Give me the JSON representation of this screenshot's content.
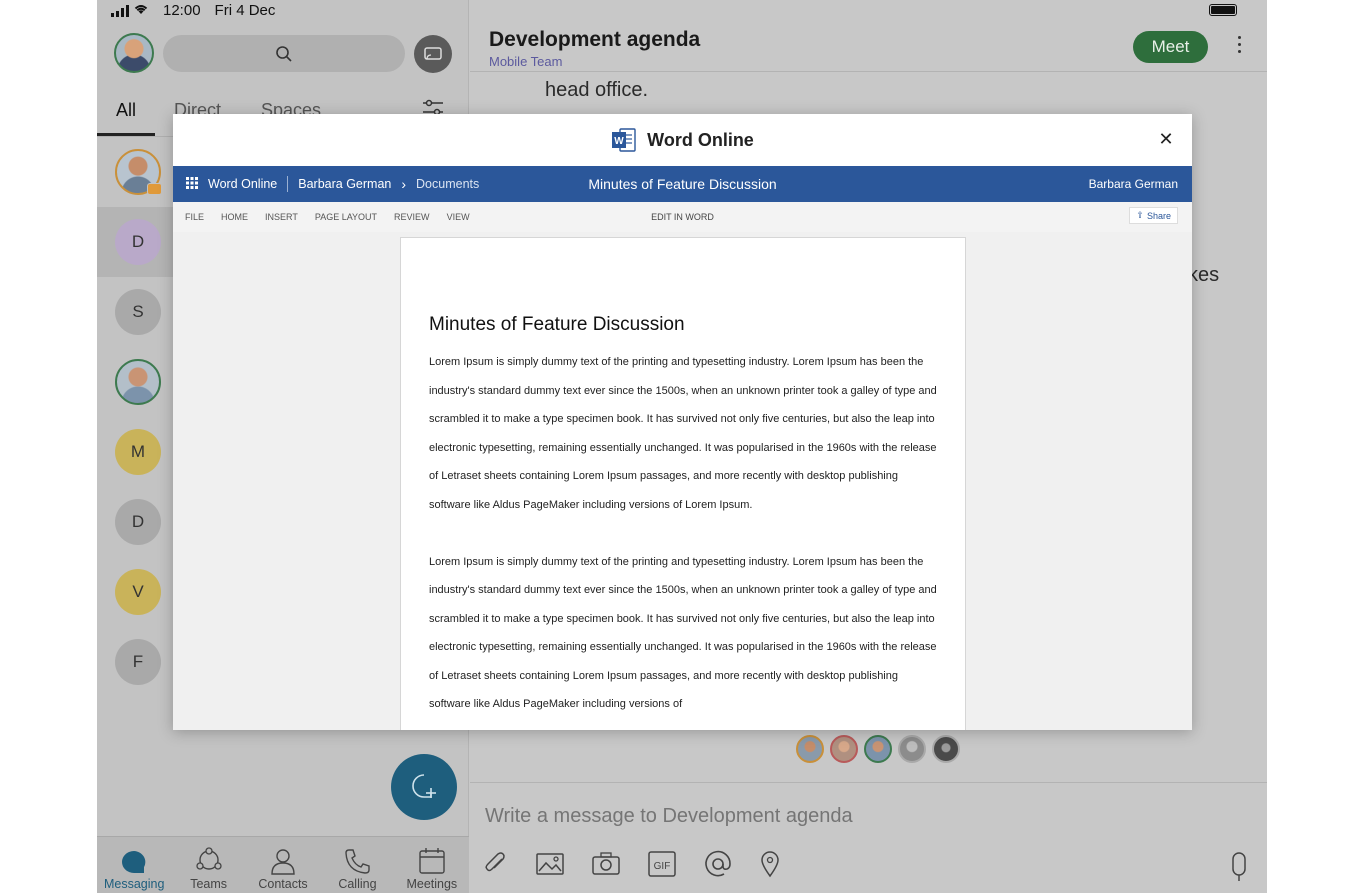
{
  "status_bar": {
    "time": "12:00",
    "date": "Fri 4 Dec"
  },
  "sidebar": {
    "tabs": [
      "All",
      "Direct",
      "Spaces"
    ],
    "active_tab": "All",
    "contacts": [
      {
        "initial": "",
        "photo": true,
        "badge": true
      },
      {
        "initial": "D",
        "color": "#b9a9c9",
        "selected": true
      },
      {
        "initial": "S",
        "color": "#a9a9a9"
      },
      {
        "initial": "",
        "photo": true,
        "ring": "#3d7a4f"
      },
      {
        "initial": "M",
        "color": "#c9b35a"
      },
      {
        "initial": "D",
        "color": "#a9a9a9"
      },
      {
        "initial": "V",
        "color": "#c9b35a"
      },
      {
        "initial": "F",
        "color": "#a9a9a9"
      }
    ],
    "nav": [
      {
        "label": "Messaging",
        "icon": "messaging-icon"
      },
      {
        "label": "Teams",
        "icon": "teams-icon"
      },
      {
        "label": "Contacts",
        "icon": "contacts-icon"
      },
      {
        "label": "Calling",
        "icon": "calling-icon"
      },
      {
        "label": "Meetings",
        "icon": "meetings-icon"
      }
    ]
  },
  "main": {
    "title": "Development agenda",
    "subtitle": "Mobile Team",
    "meet_label": "Meet",
    "message_line": "head office.",
    "message_peek": "kes",
    "compose_placeholder": "Write a message to Development agenda"
  },
  "modal": {
    "title": "Word Online",
    "word_bar": {
      "app": "Word Online",
      "user_crumb": "Barbara German",
      "folder": "Documents",
      "doc_name": "Minutes of Feature Discussion",
      "account": "Barbara German"
    },
    "ribbon": {
      "menus": [
        "FILE",
        "HOME",
        "INSERT",
        "PAGE LAYOUT",
        "REVIEW",
        "VIEW"
      ],
      "edit_label": "EDIT IN WORD",
      "share_label": "Share"
    },
    "document": {
      "heading": "Minutes of Feature Discussion",
      "paragraphs": [
        "Lorem Ipsum is simply dummy text of the printing and typesetting industry. Lorem Ipsum has been the industry's standard dummy text ever since the 1500s, when an unknown printer took a galley of type and scrambled it to make a type specimen book. It has survived not only five centuries, but also the leap into electronic typesetting, remaining essentially unchanged. It was popularised in the 1960s with the release of Letraset sheets containing Lorem Ipsum passages, and more recently with desktop publishing software like Aldus PageMaker including versions of Lorem Ipsum.",
        "Lorem Ipsum is simply dummy text of the printing and typesetting industry. Lorem Ipsum has been the industry's standard dummy text ever since the 1500s, when an unknown printer took a galley of type and scrambled it to make a type specimen book. It has survived not only five centuries, but also the leap into electronic typesetting, remaining essentially unchanged. It was popularised in the 1960s with the release of Letraset sheets containing Lorem Ipsum passages, and more recently with desktop publishing software like Aldus PageMaker including versions of"
      ]
    }
  },
  "colors": {
    "word_blue": "#2b579a",
    "meet_green": "#2e6e3c",
    "fab_blue": "#1e5e7d"
  }
}
